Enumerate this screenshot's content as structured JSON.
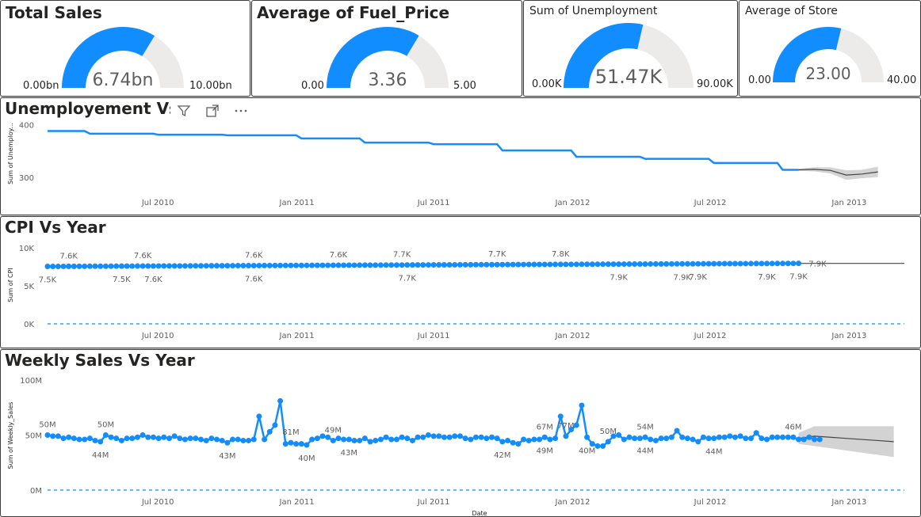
{
  "gauges": [
    {
      "title": "Total Sales",
      "style": "big",
      "value": 6.74,
      "min": 0,
      "max": 10,
      "value_label": "6.74bn",
      "min_label": "0.00bn",
      "max_label": "10.00bn"
    },
    {
      "title": "Average of Fuel_Price",
      "style": "big",
      "value": 3.36,
      "min": 0,
      "max": 5,
      "value_label": "3.36",
      "min_label": "0.00",
      "max_label": "5.00"
    },
    {
      "title": "Sum of Unemployment",
      "style": "small",
      "value": 51.47,
      "min": 0,
      "max": 90,
      "value_label": "51.47K",
      "min_label": "0.00K",
      "max_label": "90.00K"
    },
    {
      "title": "Average of Store",
      "style": "small",
      "value": 23,
      "min": 0,
      "max": 40,
      "value_label": "23.00",
      "min_label": "0.00",
      "max_label": "40.00"
    }
  ],
  "colors": {
    "series": "#118DFF",
    "gauge_track": "#EDEBE9",
    "forecast": "#444444",
    "band": "#D3D3D3",
    "zero_line": "#6BB6FF",
    "text": "#252423",
    "axis_text": "#605e5c"
  },
  "toolbar": {
    "icons": [
      "filter-icon",
      "focus-mode-icon",
      "more-options-icon"
    ]
  },
  "chart_data": [
    {
      "type": "line",
      "title": "Unemployement Vs Year",
      "ylabel": "Sum of Unemploy...",
      "xlabel": "",
      "y_ticks": [
        {
          "value": 300,
          "label": "300"
        },
        {
          "value": 400,
          "label": "400"
        }
      ],
      "ylim": [
        280,
        410
      ],
      "x_range": [
        "2010-02-05",
        "2013-03-15"
      ],
      "x_ticks": [
        {
          "date": "2010-07-01",
          "label": "Jul 2010"
        },
        {
          "date": "2011-01-01",
          "label": "Jan 2011"
        },
        {
          "date": "2011-07-01",
          "label": "Jul 2011"
        },
        {
          "date": "2012-01-01",
          "label": "Jan 2012"
        },
        {
          "date": "2012-07-01",
          "label": "Jul 2012"
        },
        {
          "date": "2013-01-01",
          "label": "Jan 2013"
        }
      ],
      "series": [
        {
          "points": [
            [
              "2010-02-05",
              388
            ],
            [
              "2010-03-26",
              388
            ],
            [
              "2010-04-02",
              383
            ],
            [
              "2010-06-25",
              383
            ],
            [
              "2010-07-02",
              381
            ],
            [
              "2010-09-24",
              381
            ],
            [
              "2010-10-01",
              380
            ],
            [
              "2010-12-31",
              380
            ],
            [
              "2011-01-07",
              374
            ],
            [
              "2011-03-25",
              374
            ],
            [
              "2011-04-01",
              366
            ],
            [
              "2011-06-24",
              366
            ],
            [
              "2011-07-01",
              363
            ],
            [
              "2011-09-23",
              363
            ],
            [
              "2011-09-30",
              351
            ],
            [
              "2011-12-30",
              351
            ],
            [
              "2012-01-06",
              339
            ],
            [
              "2012-03-30",
              339
            ],
            [
              "2012-04-06",
              335
            ],
            [
              "2012-06-29",
              335
            ],
            [
              "2012-07-06",
              327
            ],
            [
              "2012-09-28",
              327
            ],
            [
              "2012-10-05",
              314
            ],
            [
              "2012-10-26",
              314
            ]
          ]
        }
      ],
      "forecast": {
        "points": [
          [
            "2012-10-26",
            314
          ],
          [
            "2012-11-16",
            315
          ],
          [
            "2012-12-07",
            313
          ],
          [
            "2012-12-28",
            304
          ],
          [
            "2013-01-18",
            306
          ],
          [
            "2013-02-08",
            310
          ]
        ],
        "band_width": [
          2,
          4,
          6,
          9,
          8,
          10
        ]
      }
    },
    {
      "type": "line",
      "title": "CPI Vs Year",
      "ylabel": "Sum of CPI",
      "xlabel": "",
      "y_ticks": [
        {
          "value": 0,
          "label": "0K"
        },
        {
          "value": 5000,
          "label": "5K"
        },
        {
          "value": 10000,
          "label": "10K"
        }
      ],
      "ylim": [
        0,
        10000
      ],
      "x_range": [
        "2010-02-05",
        "2013-03-15"
      ],
      "x_ticks": [
        {
          "date": "2010-07-01",
          "label": "Jul 2010"
        },
        {
          "date": "2011-01-01",
          "label": "Jan 2011"
        },
        {
          "date": "2011-07-01",
          "label": "Jul 2011"
        },
        {
          "date": "2012-01-01",
          "label": "Jan 2012"
        },
        {
          "date": "2012-07-01",
          "label": "Jul 2012"
        },
        {
          "date": "2013-01-01",
          "label": "Jan 2013"
        }
      ],
      "series": [
        {
          "start": "2010-02-05",
          "step_days": 7,
          "count": 143,
          "start_value": 7550,
          "end_value": 7950
        }
      ],
      "data_labels": [
        {
          "date": "2010-02-05",
          "text": "7.5K",
          "pos": "below"
        },
        {
          "date": "2010-03-05",
          "text": "7.6K",
          "pos": "above"
        },
        {
          "date": "2010-05-14",
          "text": "7.5K",
          "pos": "below"
        },
        {
          "date": "2010-06-11",
          "text": "7.6K",
          "pos": "above"
        },
        {
          "date": "2010-06-25",
          "text": "7.6K",
          "pos": "below"
        },
        {
          "date": "2010-11-05",
          "text": "7.6K",
          "pos": "above"
        },
        {
          "date": "2010-11-05",
          "text": "7.6K",
          "pos": "below"
        },
        {
          "date": "2011-02-25",
          "text": "7.6K",
          "pos": "above"
        },
        {
          "date": "2011-05-20",
          "text": "7.7K",
          "pos": "above"
        },
        {
          "date": "2011-05-27",
          "text": "7.7K",
          "pos": "below"
        },
        {
          "date": "2011-09-23",
          "text": "7.7K",
          "pos": "above"
        },
        {
          "date": "2011-12-16",
          "text": "7.8K",
          "pos": "above"
        },
        {
          "date": "2012-03-02",
          "text": "7.9K",
          "pos": "below"
        },
        {
          "date": "2012-05-25",
          "text": "7.9K",
          "pos": "below"
        },
        {
          "date": "2012-06-15",
          "text": "7.9K",
          "pos": "below"
        },
        {
          "date": "2012-09-14",
          "text": "7.9K",
          "pos": "below"
        },
        {
          "date": "2012-10-26",
          "text": "7.9K",
          "pos": "below"
        },
        {
          "date": "2012-11-02",
          "text": "7.9K",
          "pos": "right"
        }
      ],
      "forecast": {
        "points": [
          [
            "2012-10-26",
            7950
          ],
          [
            "2013-03-15",
            7950
          ]
        ]
      }
    },
    {
      "type": "line",
      "title": "Weekly Sales Vs Year",
      "ylabel": "Sum of Weekly_Sales",
      "xlabel": "Date",
      "y_ticks": [
        {
          "value": 0,
          "label": "0M"
        },
        {
          "value": 50,
          "label": "50M"
        },
        {
          "value": 100,
          "label": "100M"
        }
      ],
      "ylim": [
        0,
        100
      ],
      "x_range": [
        "2010-02-05",
        "2013-03-15"
      ],
      "x_ticks": [
        {
          "date": "2010-07-01",
          "label": "Jul 2010"
        },
        {
          "date": "2011-01-01",
          "label": "Jan 2011"
        },
        {
          "date": "2011-07-01",
          "label": "Jul 2011"
        },
        {
          "date": "2012-01-01",
          "label": "Jan 2012"
        },
        {
          "date": "2012-07-01",
          "label": "Jul 2012"
        },
        {
          "date": "2013-01-01",
          "label": "Jan 2013"
        }
      ],
      "series": [
        {
          "start": "2010-02-05",
          "step_days": 7,
          "values": [
            50,
            49,
            49,
            47,
            48,
            47,
            46,
            46,
            47,
            45,
            44,
            50,
            48,
            47,
            45,
            47,
            47,
            48,
            50,
            48,
            48,
            47,
            48,
            47,
            49,
            47,
            46,
            47,
            47,
            46,
            45,
            47,
            46,
            45,
            43,
            46,
            46,
            45,
            45,
            46,
            67,
            46,
            53,
            59,
            81,
            42,
            43,
            42,
            42,
            41,
            46,
            47,
            49,
            48,
            45,
            47,
            46,
            46,
            45,
            45,
            47,
            44,
            45,
            46,
            48,
            46,
            46,
            48,
            47,
            45,
            48,
            48,
            50,
            49,
            49,
            48,
            48,
            49,
            49,
            47,
            46,
            48,
            48,
            47,
            48,
            47,
            44,
            45,
            43,
            42,
            46,
            45,
            46,
            46,
            48,
            46,
            47,
            67,
            49,
            55,
            59,
            77,
            48,
            42,
            40,
            40,
            44,
            49,
            50,
            46,
            48,
            47,
            47,
            48,
            46,
            45,
            47,
            47,
            48,
            54,
            48,
            47,
            46,
            44,
            48,
            47,
            47,
            48,
            48,
            49,
            48,
            49,
            47,
            47,
            52,
            47,
            46,
            48,
            48,
            48,
            48,
            48,
            46,
            46,
            48,
            46,
            46
          ]
        }
      ],
      "data_labels": [
        {
          "date": "2010-02-05",
          "text": "50M",
          "pos": "above"
        },
        {
          "date": "2010-04-16",
          "text": "44M",
          "pos": "below"
        },
        {
          "date": "2010-04-23",
          "text": "50M",
          "pos": "above"
        },
        {
          "date": "2010-10-01",
          "text": "43M",
          "pos": "below"
        },
        {
          "date": "2010-12-24",
          "text": "81M",
          "pos": "above"
        },
        {
          "date": "2011-01-14",
          "text": "40M",
          "pos": "below"
        },
        {
          "date": "2011-02-18",
          "text": "49M",
          "pos": "above"
        },
        {
          "date": "2011-03-11",
          "text": "43M",
          "pos": "below"
        },
        {
          "date": "2011-09-30",
          "text": "42M",
          "pos": "below"
        },
        {
          "date": "2011-11-25",
          "text": "67M",
          "pos": "above"
        },
        {
          "date": "2011-11-25",
          "text": "49M",
          "pos": "below"
        },
        {
          "date": "2011-12-23",
          "text": "77M",
          "pos": "above"
        },
        {
          "date": "2012-01-20",
          "text": "40M",
          "pos": "below"
        },
        {
          "date": "2012-02-17",
          "text": "50M",
          "pos": "above"
        },
        {
          "date": "2012-04-06",
          "text": "54M",
          "pos": "above"
        },
        {
          "date": "2012-04-06",
          "text": "44M",
          "pos": "below"
        },
        {
          "date": "2012-07-06",
          "text": "44M",
          "pos": "below"
        },
        {
          "date": "2012-10-19",
          "text": "46M",
          "pos": "above"
        }
      ],
      "forecast": {
        "points": [
          [
            "2012-10-26",
            47
          ],
          [
            "2012-11-16",
            49
          ],
          [
            "2012-12-07",
            48
          ],
          [
            "2012-12-28",
            47
          ],
          [
            "2013-01-18",
            46
          ],
          [
            "2013-02-08",
            45
          ],
          [
            "2013-03-01",
            44
          ]
        ],
        "band_width": [
          5,
          9,
          10,
          11,
          12,
          13,
          14
        ]
      }
    }
  ]
}
